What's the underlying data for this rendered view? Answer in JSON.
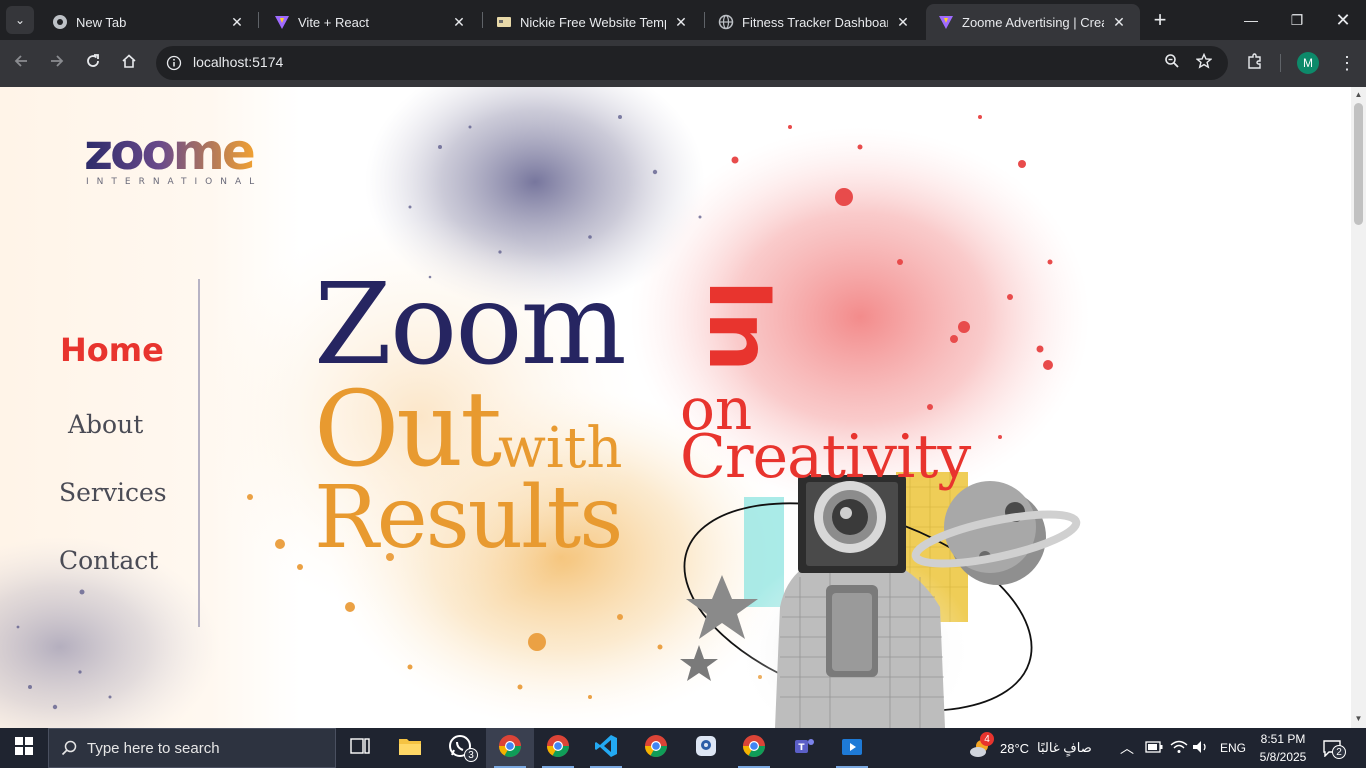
{
  "browser": {
    "tabs": [
      {
        "title": "New Tab",
        "icon": "chrome-icon"
      },
      {
        "title": "Vite + React",
        "icon": "vite-icon"
      },
      {
        "title": "Nickie Free Website Templat",
        "icon": "template-icon"
      },
      {
        "title": "Fitness Tracker Dashboard",
        "icon": "globe-icon"
      },
      {
        "title": "Zoome Advertising | Creativ",
        "icon": "vite-icon",
        "active": true
      }
    ],
    "url": "localhost:5174",
    "profile_initial": "M"
  },
  "page": {
    "logo": {
      "word": "zoome",
      "sub": "INTERNATIONAL"
    },
    "nav": [
      {
        "label": "Home",
        "active": true
      },
      {
        "label": "About"
      },
      {
        "label": "Services"
      },
      {
        "label": "Contact"
      }
    ],
    "headline": {
      "zoom": "Zoom",
      "in": "In",
      "out": "Out",
      "with": "with",
      "results": "Results",
      "on": "on",
      "creativity": "Creativity"
    },
    "colors": {
      "navy": "#262561",
      "orange": "#e89a30",
      "red": "#e8342e"
    }
  },
  "taskbar": {
    "search_placeholder": "Type here to search",
    "whatsapp_badge": "3",
    "weather_badge": "4",
    "weather_temp": "28°C",
    "weather_text": "صافٍ غالبًا",
    "language": "ENG",
    "time": "8:51 PM",
    "date": "5/8/2025",
    "notifications": "2"
  }
}
